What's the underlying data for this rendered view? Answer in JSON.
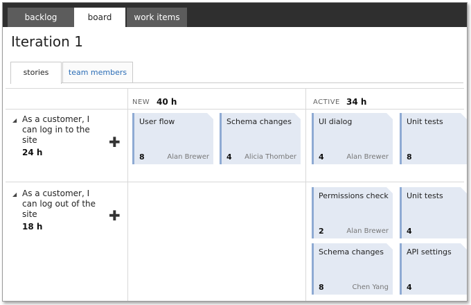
{
  "nav": {
    "tabs": [
      {
        "label": "backlog"
      },
      {
        "label": "board"
      },
      {
        "label": "work items"
      }
    ]
  },
  "page_title": "Iteration 1",
  "subtabs": [
    {
      "label": "stories"
    },
    {
      "label": "team members"
    }
  ],
  "columns": [
    {
      "name": "NEW",
      "hours": "40 h"
    },
    {
      "name": "ACTIVE",
      "hours": "34 h"
    }
  ],
  "stories": [
    {
      "text": "As a customer, I can log in to the site",
      "hours": "24 h",
      "cards": [
        {
          "title": "User flow",
          "num": "8",
          "owner": "Alan Brewer"
        },
        {
          "title": "Schema changes",
          "num": "4",
          "owner": "Alicia Thomber"
        },
        {
          "title": "UI dialog",
          "num": "4",
          "owner": "Alan Brewer"
        },
        {
          "title": "Unit tests",
          "num": "8",
          "owner": ""
        }
      ]
    },
    {
      "text": "As a customer, I can log out of the site",
      "hours": "18 h",
      "cards": [
        {
          "title": "Permissions check",
          "num": "2",
          "owner": "Alan Brewer"
        },
        {
          "title": "Unit tests",
          "num": "4",
          "owner": ""
        },
        {
          "title": "Schema changes",
          "num": "8",
          "owner": "Chen Yang"
        },
        {
          "title": "API settings",
          "num": "4",
          "owner": ""
        }
      ]
    }
  ],
  "icons": {
    "expand": "expanded-triangle-icon",
    "add": "add-plus-icon"
  },
  "colors": {
    "topbar": "#2f2f2f",
    "card_bg": "#e3e9f3",
    "card_stripe": "#8eaad3",
    "link": "#2a6cb5"
  }
}
